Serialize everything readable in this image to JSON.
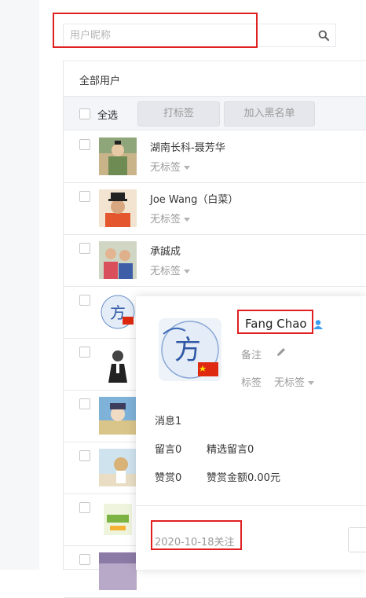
{
  "search": {
    "placeholder": "用户昵称"
  },
  "list": {
    "title": "全部用户",
    "toolbar": {
      "select_all": "全选",
      "tag_button": "打标签",
      "blacklist_button": "加入黑名单"
    },
    "users": [
      {
        "name": "湖南长科-聂芳华",
        "tag": "无标签"
      },
      {
        "name": "Joe Wang（白菜）",
        "tag": "无标签"
      },
      {
        "name": "承誠成",
        "tag": "无标签"
      },
      {
        "name": "",
        "tag": ""
      },
      {
        "name": "",
        "tag": ""
      },
      {
        "name": "",
        "tag": ""
      },
      {
        "name": "",
        "tag": ""
      },
      {
        "name": "",
        "tag": ""
      }
    ]
  },
  "popover": {
    "name": "Fang Chao",
    "remark_label": "备注",
    "tag_label": "标签",
    "tag_value": "无标签",
    "messages": "消息1",
    "comments": "留言0",
    "featured_comments": "精选留言0",
    "appreciations": "赞赏0",
    "appreciation_amount": "赞赏金额0.00元",
    "follow_date": "2020-10-18关注"
  },
  "colors": {
    "highlight_box": "#e02020",
    "user_icon": "#3b9cf0"
  }
}
